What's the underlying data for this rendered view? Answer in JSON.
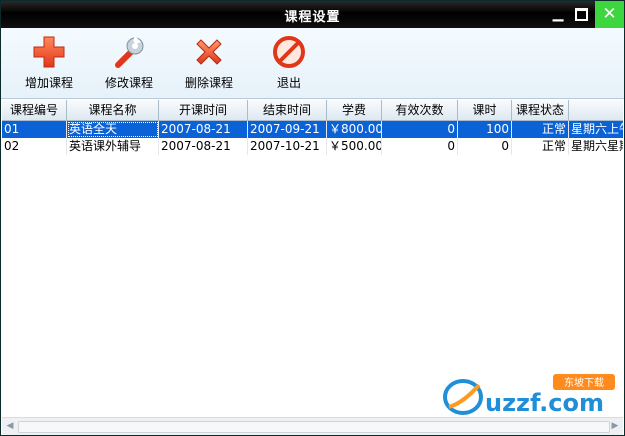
{
  "window": {
    "title": "课程设置",
    "close_glyph": "✕",
    "min_glyph": "▁"
  },
  "toolbar": {
    "buttons": [
      {
        "label": "增加课程",
        "icon": "plus-icon"
      },
      {
        "label": "修改课程",
        "icon": "wrench-icon"
      },
      {
        "label": "删除课程",
        "icon": "x-icon"
      },
      {
        "label": "退出",
        "icon": "no-entry-icon"
      }
    ]
  },
  "table": {
    "columns": [
      "课程编号",
      "课程名称",
      "开课时间",
      "结束时间",
      "学费",
      "有效次数",
      "课时",
      "课程状态",
      ""
    ],
    "rows": [
      {
        "id": "01",
        "name": "英语全天",
        "start": "2007-08-21",
        "end": "2007-09-21",
        "fee": "￥800.00",
        "valid": "0",
        "hours": "100",
        "status": "正常",
        "extra": "星期六上午"
      },
      {
        "id": "02",
        "name": "英语课外辅导",
        "start": "2007-08-21",
        "end": "2007-10-21",
        "fee": "￥500.00",
        "valid": "0",
        "hours": "0",
        "status": "正常",
        "extra": "星期六星期"
      }
    ],
    "selected_row": 0
  },
  "watermark": {
    "text": "uzzf.com",
    "badge": "东坡下载"
  },
  "colors": {
    "selection": "#0a62d6",
    "close_button": "#3ed63e",
    "titlebar": "#000000"
  }
}
